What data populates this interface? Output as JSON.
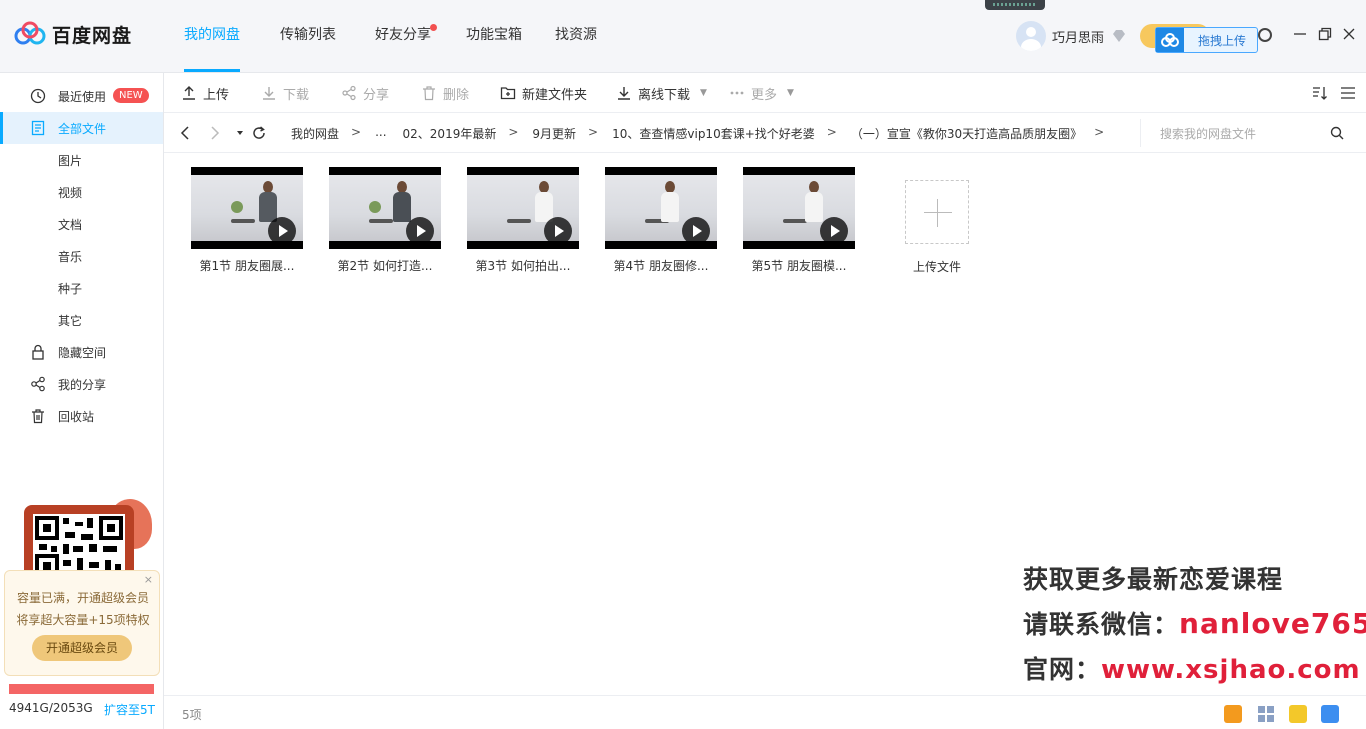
{
  "app": {
    "name": "百度网盘"
  },
  "nav": [
    {
      "label": "我的网盘",
      "active": true
    },
    {
      "label": "传输列表",
      "active": false
    },
    {
      "label": "好友分享",
      "active": false,
      "dot": true
    },
    {
      "label": "功能宝箱",
      "active": false
    },
    {
      "label": "找资源",
      "active": false
    }
  ],
  "user": {
    "name": "巧月思雨",
    "drag_upload": "拖拽上传"
  },
  "sidebar": {
    "items": [
      {
        "label": "最近使用",
        "icon": "clock-icon",
        "badge": "NEW"
      },
      {
        "label": "全部文件",
        "icon": "document-icon",
        "active": true
      },
      {
        "label": "图片",
        "sub": true
      },
      {
        "label": "视频",
        "sub": true
      },
      {
        "label": "文档",
        "sub": true
      },
      {
        "label": "音乐",
        "sub": true
      },
      {
        "label": "种子",
        "sub": true
      },
      {
        "label": "其它",
        "sub": true
      },
      {
        "label": "隐藏空间",
        "icon": "lock-icon"
      },
      {
        "label": "我的分享",
        "icon": "share-icon"
      },
      {
        "label": "回收站",
        "icon": "trash-icon"
      }
    ],
    "promo": {
      "close": "×",
      "line1": "容量已满，开通超级会员",
      "line2": "将享超大容量+15项特权",
      "button": "开通超级会员"
    },
    "quota": {
      "text": "4941G/2053G",
      "expand": "扩容至5T",
      "used_fraction": 1.0
    }
  },
  "toolbar": {
    "upload": "上传",
    "download": "下载",
    "share": "分享",
    "delete": "删除",
    "new_folder": "新建文件夹",
    "offline_download": "离线下载",
    "more": "更多"
  },
  "breadcrumb": {
    "items": [
      "我的网盘",
      "...",
      "02、2019年最新",
      "9月更新",
      "10、查查情感vip10套课+找个好老婆",
      "（一）宣宣《教你30天打造高品质朋友圈》"
    ],
    "separator": ">",
    "search_placeholder": "搜索我的网盘文件"
  },
  "files": [
    {
      "name": "第1节 朋友圈展..."
    },
    {
      "name": "第2节 如何打造..."
    },
    {
      "name": "第3节 如何拍出..."
    },
    {
      "name": "第4节 朋友圈修..."
    },
    {
      "name": "第5节 朋友圈模..."
    }
  ],
  "upload_tile": {
    "label": "上传文件"
  },
  "watermark": {
    "line1": "获取更多最新恋爱课程",
    "line2_prefix": "请联系微信：",
    "line2_value": "nanlove765",
    "line3_prefix": "官网：",
    "line3_value": "www.xsjhao.com"
  },
  "status": {
    "count": "5项"
  },
  "colors": {
    "accent": "#09aaff",
    "danger": "#f55252",
    "watermark_red": "#e0203a"
  }
}
